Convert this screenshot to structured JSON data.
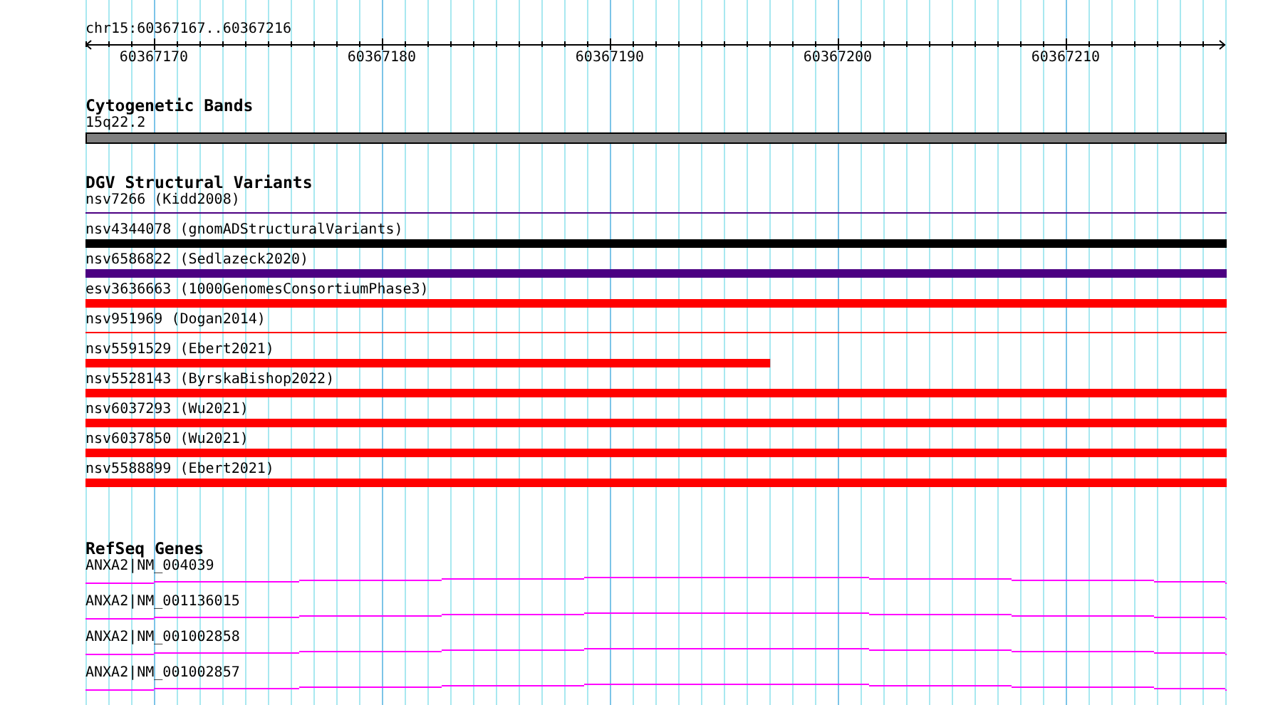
{
  "ruler": {
    "location": "chr15:60367167..60367216",
    "ticks": [
      "60367170",
      "60367180",
      "60367190",
      "60367200",
      "60367210"
    ]
  },
  "tracks": [
    {
      "kind": "cytoband",
      "title": "Cytogenetic Bands",
      "features": [
        {
          "label": "15q22.2",
          "kind": "band"
        }
      ]
    },
    {
      "kind": "variants",
      "title": "DGV Structural Variants",
      "features": [
        {
          "label": "nsv7266 (Kidd2008)",
          "kind": "thin",
          "color": "#4b0082",
          "level": 1
        },
        {
          "label": "nsv4344078 (gnomADStructuralVariants)",
          "kind": "thick",
          "color": "#000000",
          "level": 1
        },
        {
          "label": "nsv6586822 (Sedlazeck2020)",
          "kind": "thick",
          "color": "#4b0082",
          "level": 1
        },
        {
          "label": "esv3636663 (1000GenomesConsortiumPhase3)",
          "kind": "thick",
          "color": "#ff0000",
          "level": 1
        },
        {
          "label": "nsv951969 (Dogan2014)",
          "kind": "thin",
          "color": "#ff0000",
          "level": 1
        },
        {
          "label": "nsv5591529 (Ebert2021)",
          "kind": "thick",
          "color": "#ff0000",
          "level": 0.6
        },
        {
          "label": "nsv5528143 (ByrskaBishop2022)",
          "kind": "thick",
          "color": "#ff0000",
          "level": 1
        },
        {
          "label": "nsv6037293 (Wu2021)",
          "kind": "thick",
          "color": "#ff0000",
          "level": 1
        },
        {
          "label": "nsv6037850 (Wu2021)",
          "kind": "thick",
          "color": "#ff0000",
          "level": 1
        },
        {
          "label": "nsv5588899 (Ebert2021)",
          "kind": "thick",
          "color": "#ff0000",
          "level": 1
        }
      ]
    },
    {
      "kind": "genes",
      "title": "RefSeq Genes",
      "features": [
        {
          "label": "ANXA2|NM_004039",
          "kind": "transcript"
        },
        {
          "label": "ANXA2|NM_001136015",
          "kind": "transcript"
        },
        {
          "label": "ANXA2|NM_001002858",
          "kind": "transcript"
        },
        {
          "label": "ANXA2|NM_001002857",
          "kind": "transcript"
        }
      ]
    }
  ]
}
